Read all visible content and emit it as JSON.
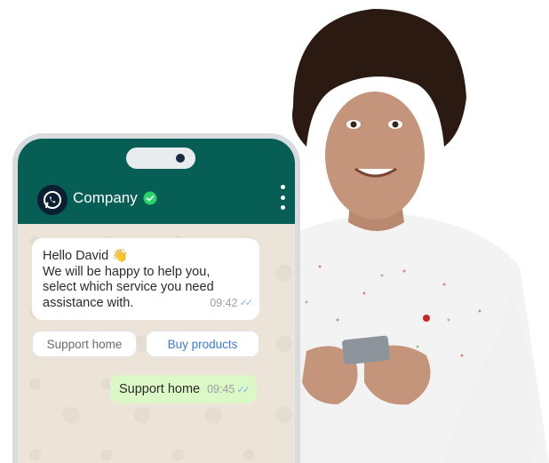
{
  "chat_header": {
    "contact_name": "Company"
  },
  "incoming_message": {
    "lines": [
      "Hello David 👋",
      "We will be happy to help you,",
      "select which service you need",
      "assistance with."
    ],
    "time": "09:42"
  },
  "quick_replies": [
    {
      "label": "Support home"
    },
    {
      "label": "Buy products"
    }
  ],
  "outgoing_message": {
    "text": "Support home",
    "time": "09:45"
  },
  "colors": {
    "header": "#075e54",
    "chat_background": "#ece4d8",
    "outgoing_bubble": "#dcf8c6",
    "verified_badge": "#25d366",
    "link_blue": "#3b7bd8"
  },
  "icons": {
    "logo": "whatsapp-logo-icon",
    "verified": "verified-check-icon",
    "menu": "more-vertical-icon",
    "read_receipt": "double-check-icon"
  }
}
